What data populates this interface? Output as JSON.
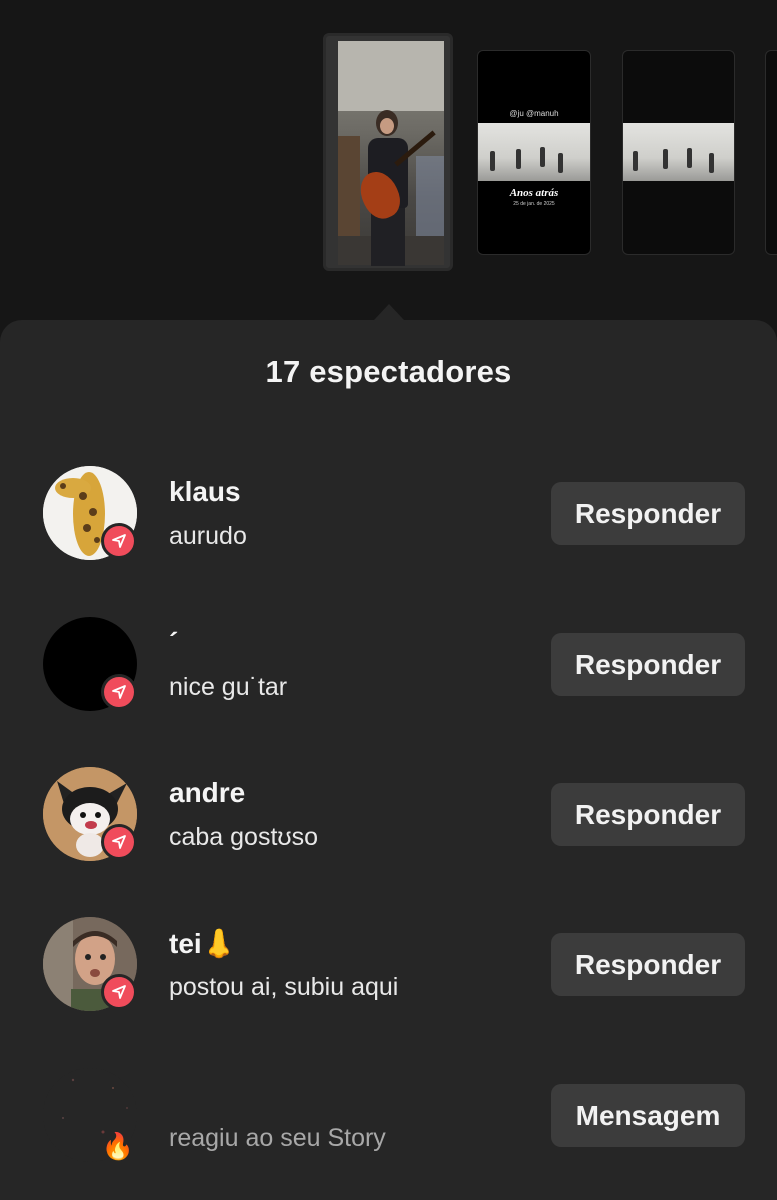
{
  "stories": {
    "story_2": {
      "mention_text": "@ju @manuh",
      "title": "Anos atrás",
      "date": "25 de jan. de 2025"
    }
  },
  "sheet": {
    "title": "17 espectadores"
  },
  "viewers": [
    {
      "username": "klaus",
      "subtext": "aurudo",
      "action": "Responder",
      "badge": "send-icon"
    },
    {
      "username": "´",
      "subtext": "nice gu˙tar",
      "action": "Responder",
      "badge": "send-icon"
    },
    {
      "username": "andre",
      "subtext": "caba gostʊso",
      "action": "Responder",
      "badge": "send-icon"
    },
    {
      "username": "tei👃",
      "subtext": "postou ai, subiu aqui",
      "action": "Responder",
      "badge": "send-icon"
    },
    {
      "username": "",
      "subtext": "reagiu ao seu Story",
      "action": "Mensagem",
      "badge": "fire-icon",
      "badge_glyph": "🔥"
    }
  ],
  "colors": {
    "background": "#161616",
    "sheet": "#262626",
    "button": "#3c3c3c",
    "badge": "#f04c5b"
  }
}
